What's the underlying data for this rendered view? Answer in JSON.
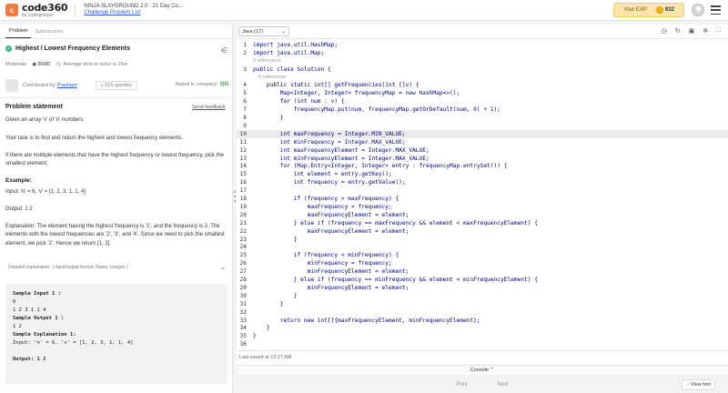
{
  "header": {
    "logo_main": "code360",
    "logo_sub": "by codingninjas",
    "breadcrumb_top": "NINJA SLAYGROUND 2.0 : 21 Day Co...",
    "breadcrumb_link": "Challenge Problem List",
    "exp_label": "Your EXP",
    "exp_value": "932"
  },
  "left": {
    "tabs": [
      "Problem",
      "Submissions"
    ],
    "title": "Highest / Lowest Frequency Elements",
    "difficulty": "Moderate",
    "score": "80/80",
    "time_label": "Average time to solve is 25m",
    "contributed_by": "Contributed by",
    "contributor": "Prashant",
    "upvotes": "215 upvotes",
    "asked_in": "Asked in company",
    "statement_heading": "Problem statement",
    "send_feedback": "Send feedback",
    "p1": "Given an array 'v' of 'n' numbers.",
    "p2": "Your task is to find and return the highest and lowest frequency elements.",
    "p3": "If there are multiple elements that have the highest frequency or lowest frequency, pick the smallest element.",
    "example_heading": "Example:",
    "example_input": "Input: 'n' = 6, 'v' = [1, 2, 3, 1, 1, 4]",
    "example_output": "Output: 1 2",
    "explanation": "Explanation: The element having the highest frequency is '1', and the frequency is 3. The elements with the lowest frequencies are '2', '3', and '4'. Since we need to pick the smallest element, we pick '2'. Hence we return [1, 2].",
    "detailed": "Detailed explanation",
    "detailed_sub": "( Input/output format, Notes, Images )",
    "sample_lines": [
      "Sample Input 1 :",
      "6",
      "1 2 3 1 1 4",
      "Sample Output 1 :",
      "1 2",
      "Sample Explanation 1:",
      "Input: 'n' = 6, 'v' = [1, 2, 3, 1, 1, 4]",
      "",
      "Output: 1 2"
    ]
  },
  "editor": {
    "language": "Java (17)",
    "code": [
      {
        "n": "1",
        "t": "import java.util.HashMap;"
      },
      {
        "n": "2",
        "t": "import java.util.Map;"
      },
      {
        "n": "",
        "t": "0 references",
        "ref": true
      },
      {
        "n": "3",
        "t": "public class Solution {"
      },
      {
        "n": "",
        "t": "    0 references",
        "ref": true
      },
      {
        "n": "4",
        "t": "    public static int[] getFrequencies(int []v) {"
      },
      {
        "n": "5",
        "t": "        Map<Integer, Integer> frequencyMap = new HashMap<>();"
      },
      {
        "n": "6",
        "t": "        for (int num : v) {"
      },
      {
        "n": "7",
        "t": "            frequencyMap.put(num, frequencyMap.getOrDefault(num, 0) + 1);"
      },
      {
        "n": "8",
        "t": "        }"
      },
      {
        "n": "9",
        "t": ""
      },
      {
        "n": "10",
        "t": "        int maxFrequency = Integer.MIN_VALUE;",
        "hl": true
      },
      {
        "n": "11",
        "t": "        int minFrequency = Integer.MAX_VALUE;"
      },
      {
        "n": "12",
        "t": "        int maxFrequencyElement = Integer.MAX_VALUE;"
      },
      {
        "n": "13",
        "t": "        int minFrequencyElement = Integer.MAX_VALUE;"
      },
      {
        "n": "14",
        "t": "        for (Map.Entry<Integer, Integer> entry : frequencyMap.entrySet()) {"
      },
      {
        "n": "15",
        "t": "            int element = entry.getKey();"
      },
      {
        "n": "16",
        "t": "            int frequency = entry.getValue();"
      },
      {
        "n": "17",
        "t": ""
      },
      {
        "n": "18",
        "t": "            if (frequency > maxFrequency) {"
      },
      {
        "n": "19",
        "t": "                maxFrequency = frequency;"
      },
      {
        "n": "20",
        "t": "                maxFrequencyElement = element;"
      },
      {
        "n": "21",
        "t": "            } else if (frequency == maxFrequency && element < maxFrequencyElement) {"
      },
      {
        "n": "22",
        "t": "                maxFrequencyElement = element;"
      },
      {
        "n": "23",
        "t": "            }"
      },
      {
        "n": "24",
        "t": ""
      },
      {
        "n": "25",
        "t": "            if (frequency < minFrequency) {"
      },
      {
        "n": "26",
        "t": "                minFrequency = frequency;"
      },
      {
        "n": "27",
        "t": "                minFrequencyElement = element;"
      },
      {
        "n": "28",
        "t": "            } else if (frequency == minFrequency && element < minFrequencyElement) {"
      },
      {
        "n": "29",
        "t": "                minFrequencyElement = element;"
      },
      {
        "n": "30",
        "t": "            }"
      },
      {
        "n": "31",
        "t": "        }"
      },
      {
        "n": "32",
        "t": ""
      },
      {
        "n": "33",
        "t": "        return new int[]{maxFrequencyElement, minFrequencyElement};"
      },
      {
        "n": "34",
        "t": "    }"
      },
      {
        "n": "35",
        "t": "}"
      },
      {
        "n": "36",
        "t": ""
      }
    ],
    "saved_text": "Last saved at 12:27 AM",
    "console_label": "Console",
    "prev_label": "Prev",
    "next_label": "Next",
    "hint_label": "View hint"
  },
  "colors": {
    "brand": "#f27a3e",
    "keyword": "#000080",
    "success": "#2eb67d",
    "exp_bg": "#fbe6a8"
  }
}
